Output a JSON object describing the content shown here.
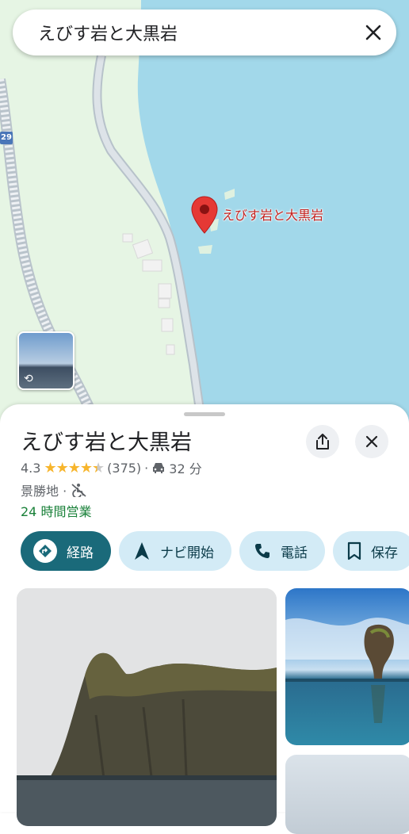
{
  "search": {
    "query": "えびす岩と大黒岩"
  },
  "map": {
    "route_shield": "29",
    "pin_label": "えびす岩と大黒岩",
    "colors": {
      "sea": "#a2d8ea",
      "land": "#e6f5e4",
      "road": "#c8d1d8",
      "pin": "#e53935"
    }
  },
  "place": {
    "name": "えびす岩と大黒岩",
    "rating": "4.3",
    "rating_value": 4.3,
    "review_count": "(375)",
    "separator": "·",
    "drive_time": "32 分",
    "category": "景勝地 ·",
    "hours": "24 時間営業"
  },
  "actions": [
    {
      "label": "経路",
      "icon": "directions-icon"
    },
    {
      "label": "ナビ開始",
      "icon": "navigation-arrow-icon"
    },
    {
      "label": "電話",
      "icon": "phone-icon"
    },
    {
      "label": "保存",
      "icon": "bookmark-icon"
    }
  ],
  "colors": {
    "accent": "#1a6a7a",
    "chip": "#d3ebf6",
    "open": "#188038",
    "star": "#f7b52c"
  }
}
